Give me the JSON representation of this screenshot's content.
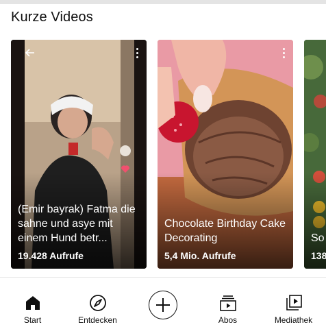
{
  "section": {
    "title": "Kurze Videos"
  },
  "shorts": [
    {
      "title": "(Emir bayrak) Fatma die sahne  und asye mit einem Hund betr...",
      "views": "19.428 Aufrufe"
    },
    {
      "title": "Chocolate Birthday Cake Decorating",
      "views": "5,4 Mio. Aufrufe"
    },
    {
      "title": "So",
      "views": "138"
    }
  ],
  "nav": {
    "items": [
      {
        "label": "Start",
        "icon": "home-icon"
      },
      {
        "label": "Entdecken",
        "icon": "compass-icon"
      },
      {
        "label": "",
        "icon": "plus-icon"
      },
      {
        "label": "Abos",
        "icon": "subscriptions-icon"
      },
      {
        "label": "Mediathek",
        "icon": "library-icon"
      }
    ]
  },
  "colors": {
    "text": "#0f0f0f",
    "overlay_text": "#ffffff",
    "divider": "#e6e6e6"
  }
}
